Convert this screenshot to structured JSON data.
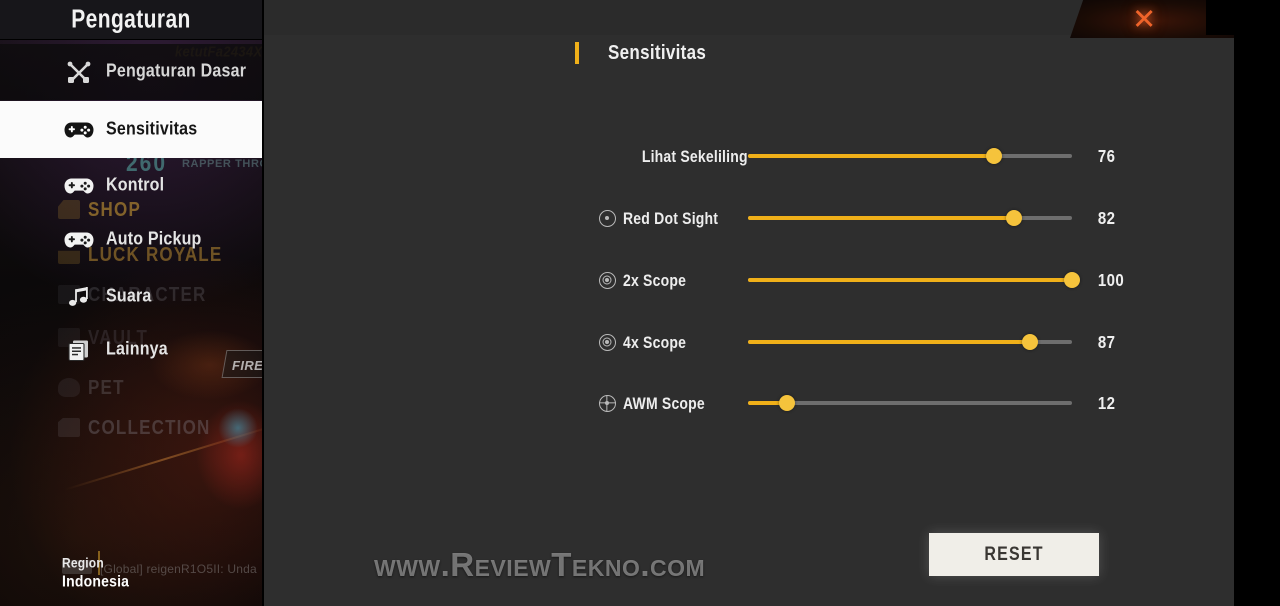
{
  "window": {
    "close_icon": "close-x-icon"
  },
  "sidebar": {
    "title": "Pengaturan",
    "items": [
      {
        "label": "Pengaturan Dasar",
        "icon": "tools-icon",
        "active": false
      },
      {
        "label": "Sensitivitas",
        "icon": "gamepad-icon",
        "active": true
      },
      {
        "label": "Kontrol",
        "icon": "gamepad-icon",
        "active": false
      },
      {
        "label": "Auto Pickup",
        "icon": "gamepad-icon",
        "active": false
      },
      {
        "label": "Suara",
        "icon": "music-note-icon",
        "active": false
      },
      {
        "label": "Lainnya",
        "icon": "documents-icon",
        "active": false
      }
    ],
    "region": {
      "label": "Region",
      "value": "Indonesia"
    },
    "background_watermarks": {
      "username": "ketutFa2434X",
      "shop": "SHOP",
      "luck_royale": "LUCK ROYALE",
      "character": "CHARACTER",
      "vault": "VAULT",
      "pet": "PET",
      "collection": "COLLECTION",
      "score": "260",
      "banner": "RAPPER THROT",
      "fire": "FIRE",
      "chat": "[Global] reigenR1O5II: Unda"
    }
  },
  "main": {
    "section_title": "Sensitivitas",
    "accent_color": "#f0b019",
    "sliders": [
      {
        "label": "Lihat Sekeliling",
        "icon": null,
        "value": 76,
        "min": 0,
        "max": 100
      },
      {
        "label": "Red Dot Sight",
        "icon": "red-dot-scope-icon",
        "value": 82,
        "min": 0,
        "max": 100
      },
      {
        "label": "2x Scope",
        "icon": "2x-scope-icon",
        "value": 100,
        "min": 0,
        "max": 100
      },
      {
        "label": "4x Scope",
        "icon": "4x-scope-icon",
        "value": 87,
        "min": 0,
        "max": 100
      },
      {
        "label": "AWM Scope",
        "icon": "awm-scope-icon",
        "value": 12,
        "min": 0,
        "max": 100
      }
    ],
    "reset_label": "RESET"
  },
  "overlay": {
    "watermark": "www.ReviewTekno.com"
  }
}
